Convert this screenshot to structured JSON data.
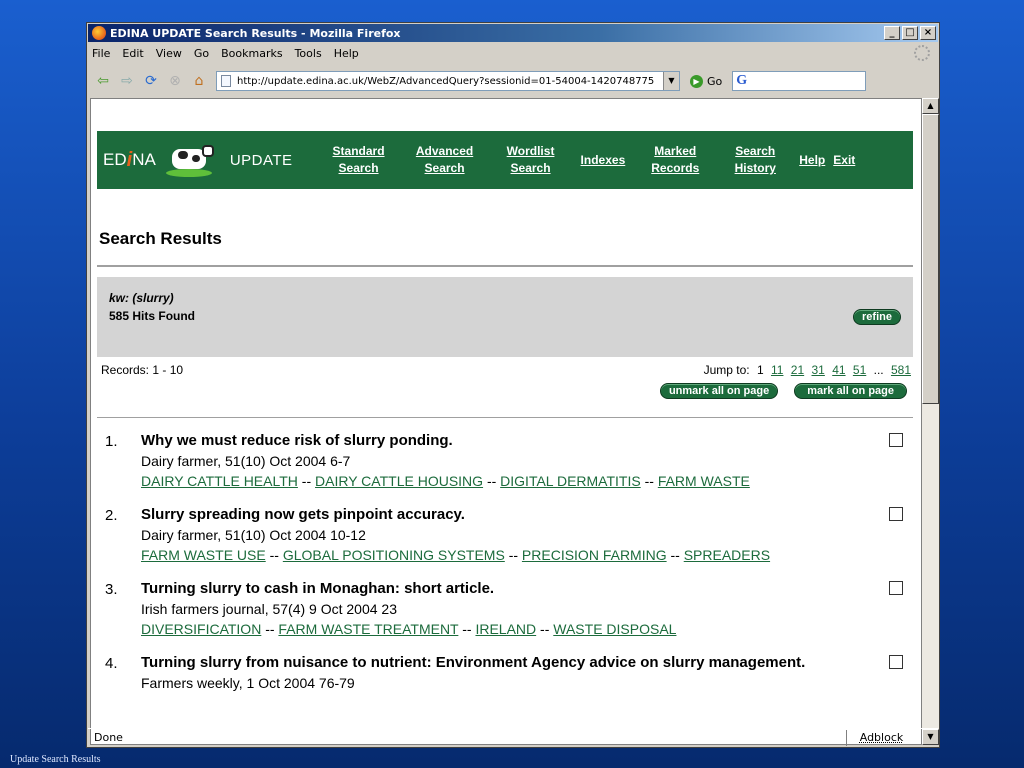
{
  "window": {
    "title": "EDINA UPDATE  Search Results - Mozilla Firefox",
    "min": "_",
    "max": "□",
    "close": "×"
  },
  "menu": [
    "File",
    "Edit",
    "View",
    "Go",
    "Bookmarks",
    "Tools",
    "Help"
  ],
  "nav": {
    "url": "http://update.edina.ac.uk/WebZ/AdvancedQuery?sessionid=01-54004-1420748775",
    "go_label": "Go"
  },
  "status": {
    "text": "Done",
    "adblock": "Adblock"
  },
  "header": {
    "logo_ed": "ED",
    "logo_i": "i",
    "logo_na": "NA",
    "logo_update": "UPDATE",
    "links": [
      {
        "line1": "Standard",
        "line2": "Search"
      },
      {
        "line1": "Advanced",
        "line2": "Search"
      },
      {
        "line1": "Wordlist",
        "line2": "Search"
      },
      {
        "line1": "Indexes",
        "line2": ""
      },
      {
        "line1": "Marked",
        "line2": "Records"
      },
      {
        "line1": "Search",
        "line2": "History"
      },
      {
        "line1": "Help",
        "line2": ""
      },
      {
        "line1": "Exit",
        "line2": ""
      }
    ]
  },
  "page": {
    "title": "Search Results",
    "query": "kw: (slurry)",
    "hits": "585 Hits Found",
    "refine": "refine",
    "records": "Records: 1 - 10",
    "jump_label": "Jump to:",
    "jump_current": "1",
    "jump_links": [
      "11",
      "21",
      "31",
      "41",
      "51"
    ],
    "jump_ellipsis": "...",
    "jump_last": "581",
    "unmark": "unmark all on page",
    "mark": "mark all on page"
  },
  "results": [
    {
      "num": "1.",
      "title": "Why we must reduce risk of slurry ponding.",
      "source": "Dairy farmer, 51(10) Oct 2004 6-7",
      "subjects": [
        "DAIRY CATTLE HEALTH",
        "DAIRY CATTLE HOUSING",
        "DIGITAL DERMATITIS",
        "FARM WASTE"
      ]
    },
    {
      "num": "2.",
      "title": "Slurry spreading now gets pinpoint accuracy.",
      "source": "Dairy farmer, 51(10) Oct 2004 10-12",
      "subjects": [
        "FARM WASTE USE",
        "GLOBAL POSITIONING SYSTEMS",
        "PRECISION FARMING",
        "SPREADERS"
      ]
    },
    {
      "num": "3.",
      "title": "Turning slurry to cash in Monaghan: short article.",
      "source": "Irish farmers journal, 57(4) 9 Oct 2004 23",
      "subjects": [
        "DIVERSIFICATION",
        "FARM WASTE TREATMENT",
        "IRELAND",
        "WASTE DISPOSAL"
      ]
    },
    {
      "num": "4.",
      "title": "Turning slurry from nuisance to nutrient: Environment Agency advice on slurry management.",
      "source": "Farmers weekly, 1 Oct 2004 76-79",
      "subjects": []
    }
  ],
  "caption": "Update Search Results"
}
